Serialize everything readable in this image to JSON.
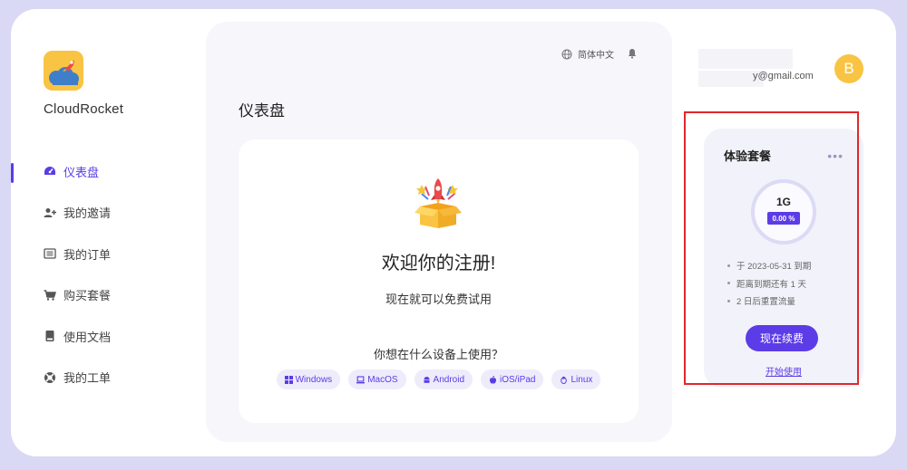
{
  "brand": {
    "name": "CloudRocket"
  },
  "sidebar": {
    "items": [
      {
        "label": "仪表盘",
        "icon": "dashboard-icon",
        "active": true
      },
      {
        "label": "我的邀请",
        "icon": "user-plus-icon"
      },
      {
        "label": "我的订单",
        "icon": "list-icon"
      },
      {
        "label": "购买套餐",
        "icon": "cart-icon"
      },
      {
        "label": "使用文档",
        "icon": "book-icon"
      },
      {
        "label": "我的工单",
        "icon": "support-icon"
      }
    ]
  },
  "header": {
    "language": "简体中文",
    "email_suffix": "y@gmail.com",
    "avatar_letter": "B"
  },
  "main": {
    "title": "仪表盘",
    "welcome": "欢迎你的注册!",
    "subtitle": "现在就可以免费试用",
    "device_question": "你想在什么设备上使用？",
    "os_options": [
      "Windows",
      "MacOS",
      "Android",
      "iOS/iPad",
      "Linux"
    ]
  },
  "plan": {
    "title": "体验套餐",
    "more": "•••",
    "data_size": "1G",
    "usage_percent": "0.00 %",
    "facts": [
      "于 2023-05-31 到期",
      "距离到期还有 1 天",
      "2 日后重置流量"
    ],
    "renew_label": "现在续费",
    "start_label": "开始使用"
  },
  "colors": {
    "accent": "#5b3ce6",
    "avatar": "#f9c443",
    "highlight": "#e0282a",
    "background": "#d9d8f5"
  }
}
